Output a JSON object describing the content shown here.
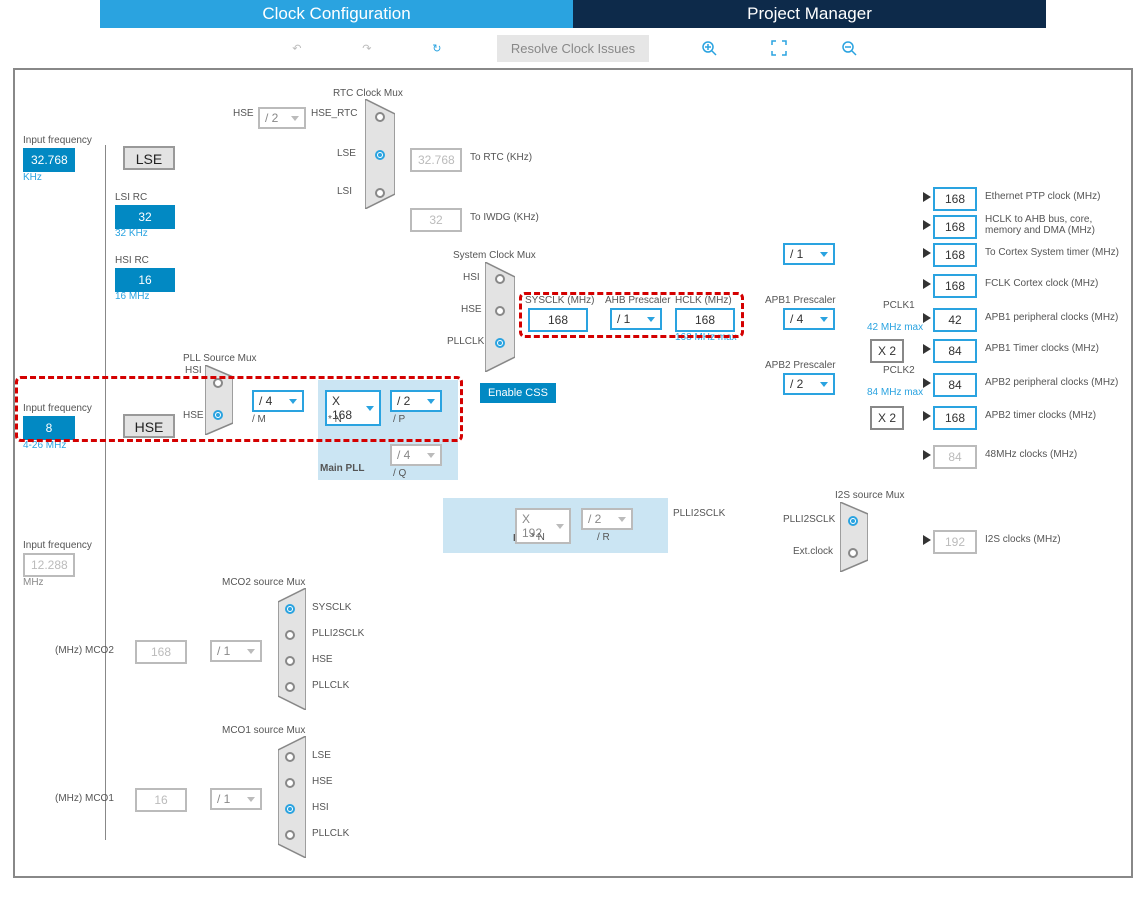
{
  "tabs": {
    "active": "Clock Configuration",
    "other": "Project Manager"
  },
  "toolbar": {
    "resolve": "Resolve Clock Issues"
  },
  "inputs": {
    "lse_freq": "32.768",
    "lse_unit": "KHz",
    "lse_lbl": "Input frequency",
    "lse_name": "LSE",
    "lsi_lbl": "LSI RC",
    "lsi_val": "32",
    "lsi_note": "32 KHz",
    "hsi_lbl": "HSI RC",
    "hsi_val": "16",
    "hsi_note": "16 MHz",
    "hse_lbl": "Input frequency",
    "hse_val": "8",
    "hse_unit": "4-26 MHz",
    "hse_name": "HSE",
    "i2s_lbl": "Input frequency",
    "i2s_val": "12.288",
    "i2s_unit": "MHz"
  },
  "rtc": {
    "title": "RTC Clock Mux",
    "hse_lbl": "HSE",
    "div": "/ 2",
    "hse_rtc": "HSE_RTC",
    "lse_lbl": "LSE",
    "lsi_lbl": "LSI",
    "rtc_val": "32.768",
    "rtc_to": "To RTC (KHz)",
    "iwdg_val": "32",
    "iwdg_to": "To IWDG (KHz)"
  },
  "pll": {
    "src_title": "PLL Source Mux",
    "hsi": "HSI",
    "hse": "HSE",
    "m": "/ 4",
    "m_lbl": "/ M",
    "n": "X 168",
    "n_lbl": "* N",
    "p": "/ 2",
    "p_lbl": "/ P",
    "q": "/ 4",
    "q_lbl": "/ Q",
    "main_lbl": "Main PLL"
  },
  "plli2s": {
    "n": "X 192",
    "n_lbl": "* N",
    "r": "/ 2",
    "r_lbl": "/ R",
    "title": "PLLI2S",
    "clk": "PLLI2SCLK"
  },
  "sys": {
    "title": "System Clock Mux",
    "hsi": "HSI",
    "hse": "HSE",
    "pllclk": "PLLCLK",
    "css": "Enable CSS",
    "sysclk_lbl": "SYSCLK (MHz)",
    "sysclk": "168",
    "ahb_lbl": "AHB Prescaler",
    "ahb": "/ 1",
    "hclk_lbl": "HCLK (MHz)",
    "hclk": "168",
    "hclk_max": "168 MHz max"
  },
  "out": {
    "eth": {
      "val": "168",
      "lbl": "Ethernet PTP clock (MHz)"
    },
    "hclk_ahb": {
      "val": "168",
      "lbl": "HCLK to AHB bus, core, memory and DMA (MHz)"
    },
    "cortex_div": "/ 1",
    "cortex": {
      "val": "168",
      "lbl": "To Cortex System timer (MHz)"
    },
    "fclk": {
      "val": "168",
      "lbl": "FCLK Cortex clock (MHz)"
    },
    "apb1_lbl": "APB1 Prescaler",
    "apb1_div": "/ 4",
    "pclk1_lbl": "PCLK1",
    "pclk1_max": "42 MHz max",
    "apb1_p": {
      "val": "42",
      "lbl": "APB1 peripheral clocks (MHz)"
    },
    "apb1_x": "X 2",
    "apb1_t": {
      "val": "84",
      "lbl": "APB1 Timer clocks (MHz)"
    },
    "apb2_lbl": "APB2 Prescaler",
    "apb2_div": "/ 2",
    "pclk2_lbl": "PCLK2",
    "pclk2_max": "84 MHz max",
    "apb2_p": {
      "val": "84",
      "lbl": "APB2 peripheral clocks (MHz)"
    },
    "apb2_x": "X 2",
    "apb2_t": {
      "val": "168",
      "lbl": "APB2 timer clocks (MHz)"
    },
    "clk48": {
      "val": "84",
      "lbl": "48MHz clocks (MHz)"
    }
  },
  "i2s": {
    "title": "I2S source Mux",
    "plli2sclk": "PLLI2SCLK",
    "ext": "Ext.clock",
    "val": "192",
    "lbl": "I2S clocks (MHz)"
  },
  "mco2": {
    "title": "MCO2 source Mux",
    "opts": [
      "SYSCLK",
      "PLLI2SCLK",
      "HSE",
      "PLLCLK"
    ],
    "div": "/ 1",
    "val": "168",
    "lbl": "(MHz) MCO2"
  },
  "mco1": {
    "title": "MCO1 source Mux",
    "opts": [
      "LSE",
      "HSE",
      "HSI",
      "PLLCLK"
    ],
    "div": "/ 1",
    "val": "16",
    "lbl": "(MHz) MCO1"
  }
}
